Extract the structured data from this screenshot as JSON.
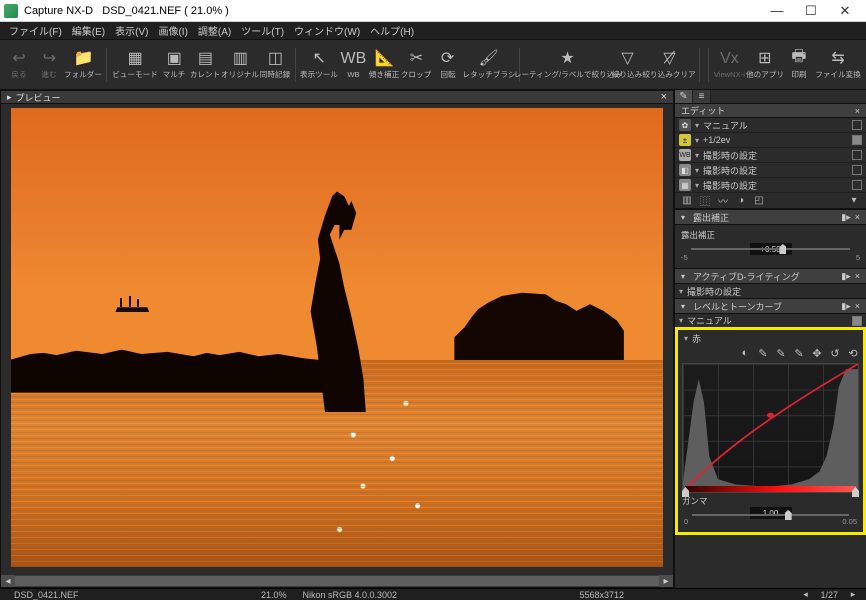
{
  "titlebar": {
    "app": "Capture NX-D",
    "file": "DSD_0421.NEF",
    "zoom": "21.0%"
  },
  "menus": [
    "ファイル(F)",
    "編集(E)",
    "表示(V)",
    "画像(I)",
    "調整(A)",
    "ツール(T)",
    "ウィンドウ(W)",
    "ヘルプ(H)"
  ],
  "toolbar": {
    "back": "戻る",
    "forward": "進む",
    "folder": "フォルダー",
    "viewmode": "ビューモード",
    "multi": "マルチ",
    "current": "カレント",
    "original": "オリジナル",
    "sync": "同時記録",
    "display_tool": "表示ツール",
    "wb": "WB",
    "tilt": "傾き補正",
    "crop": "クロップ",
    "rotate": "回転",
    "retouch": "レタッチブラシ",
    "rating_filter": "レーティング/ラベルで絞り込み",
    "filter": "絞り込み",
    "filter_clear": "絞り込みクリア",
    "viewnx": "ViewNX-i",
    "other_app": "他のアプリ",
    "print": "印刷",
    "convert": "ファイル変換"
  },
  "preview": {
    "tab": "プレビュー"
  },
  "edit": {
    "panel_title": "エディット",
    "rows": [
      {
        "icon": "gear",
        "label": "マニュアル"
      },
      {
        "icon": "exp",
        "label": "+1/2ev"
      },
      {
        "icon": "wb",
        "label": "撮影時の設定"
      },
      {
        "icon": "pc",
        "label": "撮影時の設定"
      },
      {
        "icon": "nr",
        "label": "撮影時の設定"
      }
    ],
    "exposure": {
      "title": "露出補正",
      "label": "露出補正",
      "value": "+0.50",
      "min": "-5",
      "max": "5"
    },
    "adl": {
      "title": "アクティブD-ライティング",
      "label": "撮影時の設定"
    },
    "levels": {
      "title": "レベルとトーンカーブ",
      "preset": "マニュアル"
    },
    "tonecurve": {
      "channel": "赤",
      "gamma_label": "ガンマ",
      "gamma_value": "1.00",
      "gamma_min": "0",
      "gamma_max": "0.05"
    }
  },
  "status": {
    "file": "DSD_0421.NEF",
    "zoom": "21.0%",
    "profile": "Nikon sRGB 4.0.0.3002",
    "dims": "5568x3712",
    "page": "1/27"
  }
}
